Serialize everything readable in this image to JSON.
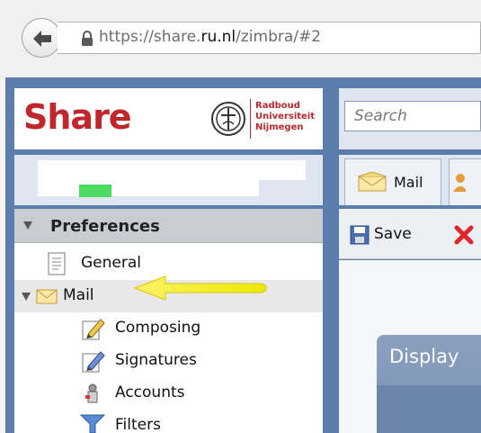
{
  "browser": {
    "url_prefix": "https://share.",
    "url_domain": "ru.nl",
    "url_suffix": "/zimbra/#2"
  },
  "header": {
    "logo_text": "Share",
    "university_lines": [
      "Radboud",
      "Universiteit",
      "Nijmegen"
    ],
    "search_placeholder": "Search"
  },
  "sidebar": {
    "section_title": "Preferences",
    "items": [
      {
        "label": "General",
        "icon": "general-document-icon"
      },
      {
        "label": "Mail",
        "icon": "mail-envelope-icon",
        "selected": true,
        "expanded": true
      },
      {
        "label": "Composing",
        "icon": "composing-icon"
      },
      {
        "label": "Signatures",
        "icon": "signatures-icon"
      },
      {
        "label": "Accounts",
        "icon": "accounts-icon"
      },
      {
        "label": "Filters",
        "icon": "filters-icon"
      }
    ]
  },
  "tabs": {
    "mail_label": "Mail"
  },
  "toolbar": {
    "save_label": "Save"
  },
  "content": {
    "panel_title": "Display"
  },
  "colors": {
    "brand_red": "#c0272d",
    "frame_blue": "#5b7dab",
    "arrow_yellow": "#f4f000",
    "quota_green": "#4cd964"
  }
}
